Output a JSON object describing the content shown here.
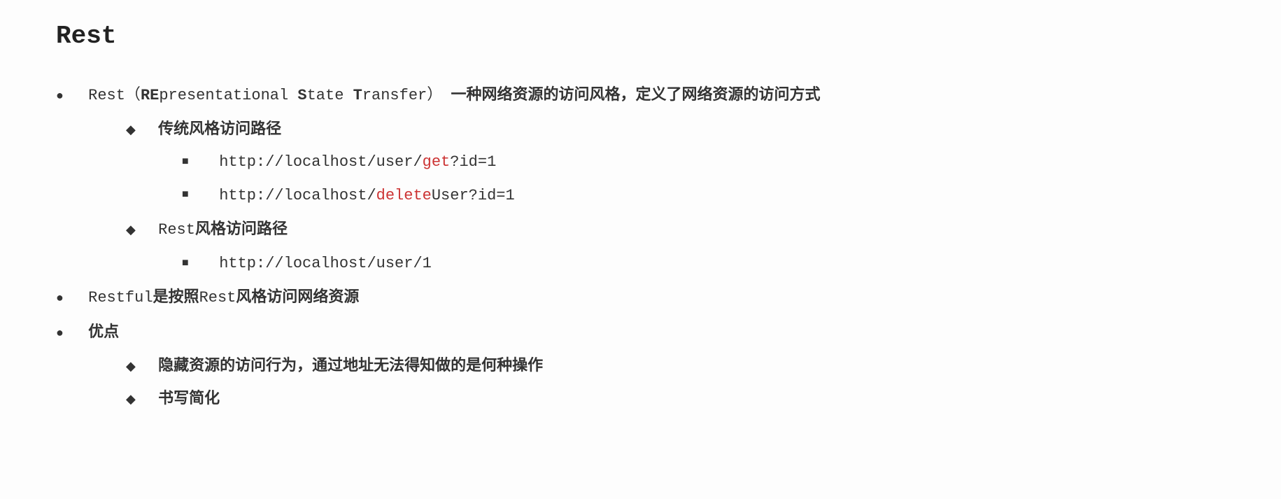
{
  "title": "Rest",
  "item1": {
    "prefix": "Rest（",
    "b1": "RE",
    "t1": "presentational ",
    "b2": "S",
    "t2": "tate ",
    "b3": "T",
    "t3": "ransfer）",
    "desc": "一种网络资源的访问风格，定义了网络资源的访问方式"
  },
  "sub1": {
    "label": "传统风格访问路径",
    "url1_pre": "http://localhost/user/",
    "url1_red": "get",
    "url1_post": "?id=1",
    "url2_pre": "http://localhost/",
    "url2_red": "delete",
    "url2_post": "User?id=1"
  },
  "sub2": {
    "prefix": "Rest",
    "label": "风格访问路径",
    "url1": "http://localhost/user/1"
  },
  "item2": {
    "p1": "Restful",
    "b1": "是按照",
    "p2": "Rest",
    "b2": "风格访问网络资源"
  },
  "item3": {
    "label": "优点",
    "adv1": "隐藏资源的访问行为，通过地址无法得知做的是何种操作",
    "adv2": "书写简化"
  }
}
